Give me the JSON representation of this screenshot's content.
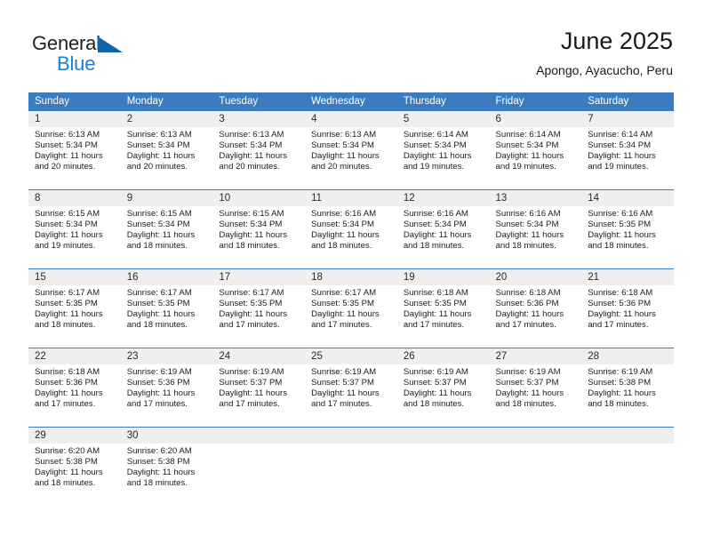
{
  "brand": {
    "name_part1": "General",
    "name_part2": "Blue",
    "triangle_color": "#1464a5",
    "blue_color": "#1a7fd4"
  },
  "header": {
    "title": "June 2025",
    "location": "Apongo, Ayacucho, Peru"
  },
  "theme": {
    "header_blue": "#3b7cc0",
    "daynum_gray": "#efefef",
    "text": "#1c1c1c"
  },
  "calendar": {
    "weekday_headers": [
      "Sunday",
      "Monday",
      "Tuesday",
      "Wednesday",
      "Thursday",
      "Friday",
      "Saturday"
    ],
    "weeks": [
      [
        {
          "day": "1",
          "sunrise": "Sunrise: 6:13 AM",
          "sunset": "Sunset: 5:34 PM",
          "daylight1": "Daylight: 11 hours",
          "daylight2": "and 20 minutes."
        },
        {
          "day": "2",
          "sunrise": "Sunrise: 6:13 AM",
          "sunset": "Sunset: 5:34 PM",
          "daylight1": "Daylight: 11 hours",
          "daylight2": "and 20 minutes."
        },
        {
          "day": "3",
          "sunrise": "Sunrise: 6:13 AM",
          "sunset": "Sunset: 5:34 PM",
          "daylight1": "Daylight: 11 hours",
          "daylight2": "and 20 minutes."
        },
        {
          "day": "4",
          "sunrise": "Sunrise: 6:13 AM",
          "sunset": "Sunset: 5:34 PM",
          "daylight1": "Daylight: 11 hours",
          "daylight2": "and 20 minutes."
        },
        {
          "day": "5",
          "sunrise": "Sunrise: 6:14 AM",
          "sunset": "Sunset: 5:34 PM",
          "daylight1": "Daylight: 11 hours",
          "daylight2": "and 19 minutes."
        },
        {
          "day": "6",
          "sunrise": "Sunrise: 6:14 AM",
          "sunset": "Sunset: 5:34 PM",
          "daylight1": "Daylight: 11 hours",
          "daylight2": "and 19 minutes."
        },
        {
          "day": "7",
          "sunrise": "Sunrise: 6:14 AM",
          "sunset": "Sunset: 5:34 PM",
          "daylight1": "Daylight: 11 hours",
          "daylight2": "and 19 minutes."
        }
      ],
      [
        {
          "day": "8",
          "sunrise": "Sunrise: 6:15 AM",
          "sunset": "Sunset: 5:34 PM",
          "daylight1": "Daylight: 11 hours",
          "daylight2": "and 19 minutes."
        },
        {
          "day": "9",
          "sunrise": "Sunrise: 6:15 AM",
          "sunset": "Sunset: 5:34 PM",
          "daylight1": "Daylight: 11 hours",
          "daylight2": "and 18 minutes."
        },
        {
          "day": "10",
          "sunrise": "Sunrise: 6:15 AM",
          "sunset": "Sunset: 5:34 PM",
          "daylight1": "Daylight: 11 hours",
          "daylight2": "and 18 minutes."
        },
        {
          "day": "11",
          "sunrise": "Sunrise: 6:16 AM",
          "sunset": "Sunset: 5:34 PM",
          "daylight1": "Daylight: 11 hours",
          "daylight2": "and 18 minutes."
        },
        {
          "day": "12",
          "sunrise": "Sunrise: 6:16 AM",
          "sunset": "Sunset: 5:34 PM",
          "daylight1": "Daylight: 11 hours",
          "daylight2": "and 18 minutes."
        },
        {
          "day": "13",
          "sunrise": "Sunrise: 6:16 AM",
          "sunset": "Sunset: 5:34 PM",
          "daylight1": "Daylight: 11 hours",
          "daylight2": "and 18 minutes."
        },
        {
          "day": "14",
          "sunrise": "Sunrise: 6:16 AM",
          "sunset": "Sunset: 5:35 PM",
          "daylight1": "Daylight: 11 hours",
          "daylight2": "and 18 minutes."
        }
      ],
      [
        {
          "day": "15",
          "sunrise": "Sunrise: 6:17 AM",
          "sunset": "Sunset: 5:35 PM",
          "daylight1": "Daylight: 11 hours",
          "daylight2": "and 18 minutes."
        },
        {
          "day": "16",
          "sunrise": "Sunrise: 6:17 AM",
          "sunset": "Sunset: 5:35 PM",
          "daylight1": "Daylight: 11 hours",
          "daylight2": "and 18 minutes."
        },
        {
          "day": "17",
          "sunrise": "Sunrise: 6:17 AM",
          "sunset": "Sunset: 5:35 PM",
          "daylight1": "Daylight: 11 hours",
          "daylight2": "and 17 minutes."
        },
        {
          "day": "18",
          "sunrise": "Sunrise: 6:17 AM",
          "sunset": "Sunset: 5:35 PM",
          "daylight1": "Daylight: 11 hours",
          "daylight2": "and 17 minutes."
        },
        {
          "day": "19",
          "sunrise": "Sunrise: 6:18 AM",
          "sunset": "Sunset: 5:35 PM",
          "daylight1": "Daylight: 11 hours",
          "daylight2": "and 17 minutes."
        },
        {
          "day": "20",
          "sunrise": "Sunrise: 6:18 AM",
          "sunset": "Sunset: 5:36 PM",
          "daylight1": "Daylight: 11 hours",
          "daylight2": "and 17 minutes."
        },
        {
          "day": "21",
          "sunrise": "Sunrise: 6:18 AM",
          "sunset": "Sunset: 5:36 PM",
          "daylight1": "Daylight: 11 hours",
          "daylight2": "and 17 minutes."
        }
      ],
      [
        {
          "day": "22",
          "sunrise": "Sunrise: 6:18 AM",
          "sunset": "Sunset: 5:36 PM",
          "daylight1": "Daylight: 11 hours",
          "daylight2": "and 17 minutes."
        },
        {
          "day": "23",
          "sunrise": "Sunrise: 6:19 AM",
          "sunset": "Sunset: 5:36 PM",
          "daylight1": "Daylight: 11 hours",
          "daylight2": "and 17 minutes."
        },
        {
          "day": "24",
          "sunrise": "Sunrise: 6:19 AM",
          "sunset": "Sunset: 5:37 PM",
          "daylight1": "Daylight: 11 hours",
          "daylight2": "and 17 minutes."
        },
        {
          "day": "25",
          "sunrise": "Sunrise: 6:19 AM",
          "sunset": "Sunset: 5:37 PM",
          "daylight1": "Daylight: 11 hours",
          "daylight2": "and 17 minutes."
        },
        {
          "day": "26",
          "sunrise": "Sunrise: 6:19 AM",
          "sunset": "Sunset: 5:37 PM",
          "daylight1": "Daylight: 11 hours",
          "daylight2": "and 18 minutes."
        },
        {
          "day": "27",
          "sunrise": "Sunrise: 6:19 AM",
          "sunset": "Sunset: 5:37 PM",
          "daylight1": "Daylight: 11 hours",
          "daylight2": "and 18 minutes."
        },
        {
          "day": "28",
          "sunrise": "Sunrise: 6:19 AM",
          "sunset": "Sunset: 5:38 PM",
          "daylight1": "Daylight: 11 hours",
          "daylight2": "and 18 minutes."
        }
      ],
      [
        {
          "day": "29",
          "sunrise": "Sunrise: 6:20 AM",
          "sunset": "Sunset: 5:38 PM",
          "daylight1": "Daylight: 11 hours",
          "daylight2": "and 18 minutes."
        },
        {
          "day": "30",
          "sunrise": "Sunrise: 6:20 AM",
          "sunset": "Sunset: 5:38 PM",
          "daylight1": "Daylight: 11 hours",
          "daylight2": "and 18 minutes."
        },
        {
          "day": "",
          "sunrise": "",
          "sunset": "",
          "daylight1": "",
          "daylight2": ""
        },
        {
          "day": "",
          "sunrise": "",
          "sunset": "",
          "daylight1": "",
          "daylight2": ""
        },
        {
          "day": "",
          "sunrise": "",
          "sunset": "",
          "daylight1": "",
          "daylight2": ""
        },
        {
          "day": "",
          "sunrise": "",
          "sunset": "",
          "daylight1": "",
          "daylight2": ""
        },
        {
          "day": "",
          "sunrise": "",
          "sunset": "",
          "daylight1": "",
          "daylight2": ""
        }
      ]
    ]
  }
}
